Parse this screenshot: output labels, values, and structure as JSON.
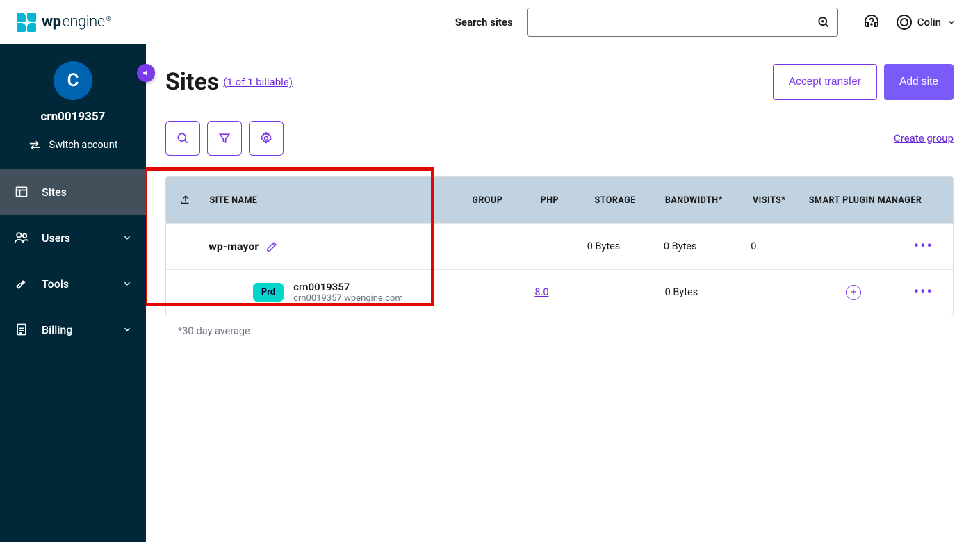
{
  "brand": {
    "wp": "wp",
    "engine": "engine"
  },
  "search": {
    "label": "Search sites",
    "placeholder": ""
  },
  "user": {
    "name": "Colin"
  },
  "sidebar": {
    "account_initial": "C",
    "account_name": "crn0019357",
    "switch_label": "Switch account",
    "items": [
      {
        "label": "Sites"
      },
      {
        "label": "Users"
      },
      {
        "label": "Tools"
      },
      {
        "label": "Billing"
      }
    ]
  },
  "page": {
    "title": "Sites",
    "billable_text": "(1 of 1 billable)",
    "accept_transfer": "Accept transfer",
    "add_site": "Add site",
    "create_group": "Create group"
  },
  "table": {
    "headers": {
      "site_name": "SITE NAME",
      "group": "GROUP",
      "php": "PHP",
      "storage": "STORAGE",
      "bandwidth": "BANDWIDTH*",
      "visits": "VISITS*",
      "spm": "SMART PLUGIN MANAGER"
    },
    "site": {
      "name": "wp-mayor",
      "group": "",
      "php": "",
      "storage": "0 Bytes",
      "bandwidth": "0 Bytes",
      "visits": "0"
    },
    "env": {
      "badge": "Prd",
      "name": "crn0019357",
      "domain": "crn0019357.wpengine.com",
      "php": "8.0",
      "storage": "",
      "bandwidth": "0 Bytes",
      "visits": ""
    },
    "footnote": "*30-day average"
  }
}
